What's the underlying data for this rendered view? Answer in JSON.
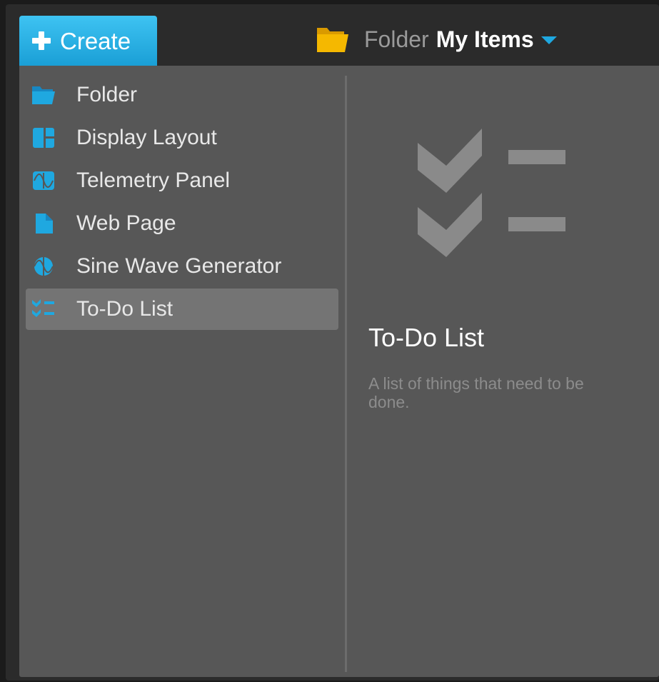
{
  "header": {
    "create_label": "Create",
    "breadcrumb_kind": "Folder",
    "breadcrumb_name": "My Items"
  },
  "menu": {
    "items": [
      {
        "label": "Folder",
        "icon": "folder-icon"
      },
      {
        "label": "Display Layout",
        "icon": "display-layout-icon"
      },
      {
        "label": "Telemetry Panel",
        "icon": "telemetry-panel-icon"
      },
      {
        "label": "Web Page",
        "icon": "web-page-icon"
      },
      {
        "label": "Sine Wave Generator",
        "icon": "sine-wave-icon"
      },
      {
        "label": "To-Do List",
        "icon": "todo-list-icon",
        "selected": true
      }
    ]
  },
  "preview": {
    "icon": "todo-list-icon",
    "title": "To-Do List",
    "description": "A list of things that need to be done."
  },
  "colors": {
    "accent": "#1fa8e0",
    "folder_yellow": "#f5b800",
    "menu_bg": "#575757",
    "selected_bg": "#747474",
    "frame_bg": "#2b2b2b"
  }
}
